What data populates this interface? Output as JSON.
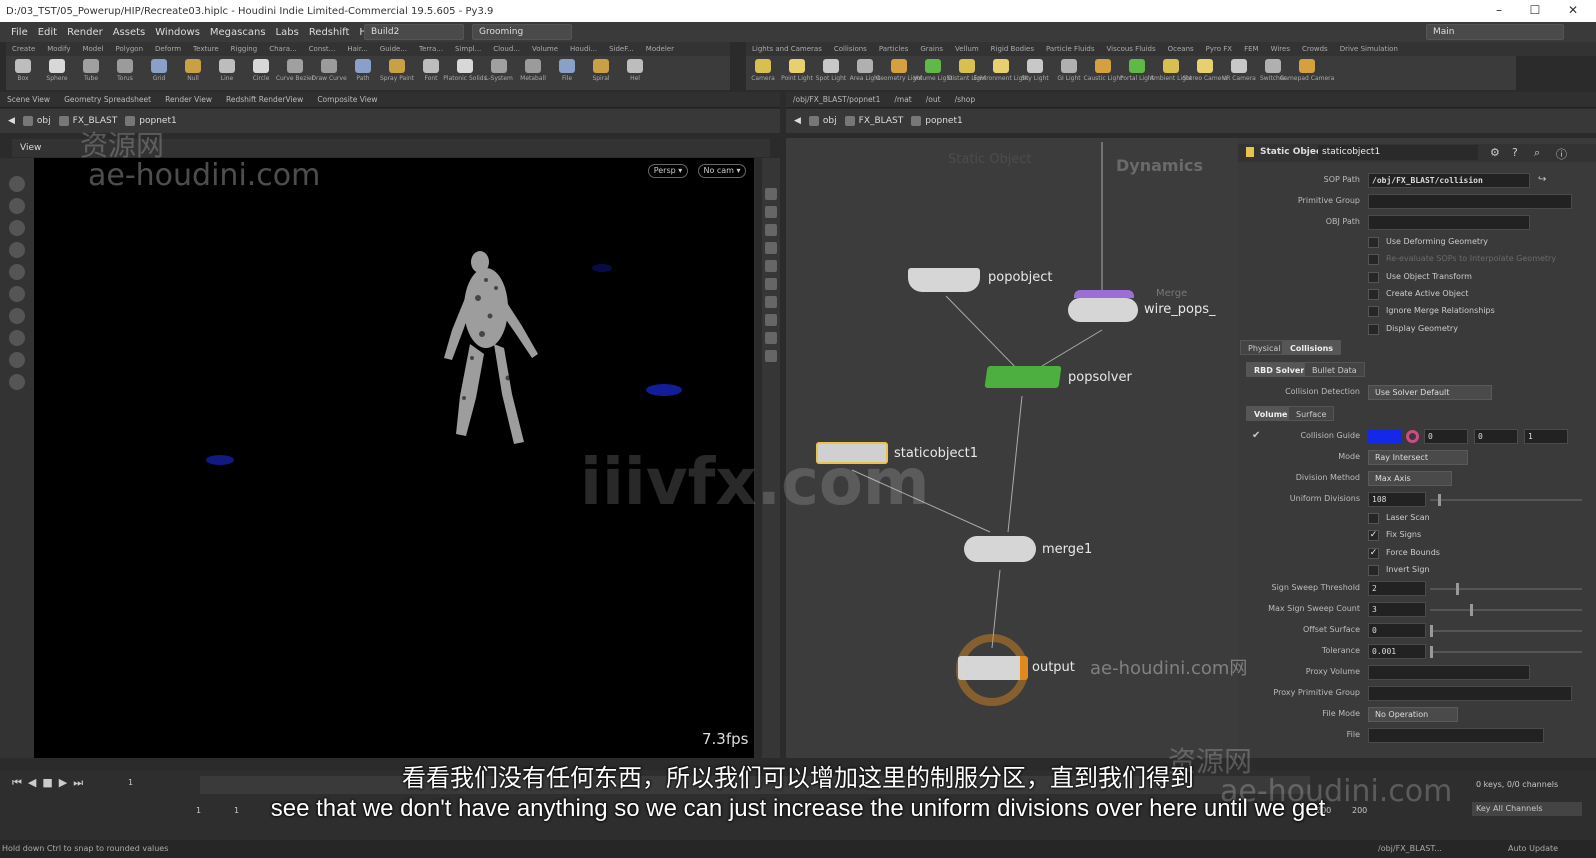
{
  "window": {
    "title": "D:/03_TST/05_Powerup/HIP/Recreate03.hiplc - Houdini Indie Limited-Commercial 19.5.605 - Py3.9"
  },
  "menu": [
    "File",
    "Edit",
    "Render",
    "Assets",
    "Windows",
    "Megascans",
    "Labs",
    "Redshift",
    "Help"
  ],
  "desktop": {
    "build": "Build2",
    "grooming": "Grooming",
    "main": "Main"
  },
  "shelf_tabs_left": [
    "Create",
    "Modify",
    "Model",
    "Polygon",
    "Deform",
    "Texture",
    "Rigging",
    "Chara...",
    "Const...",
    "Hair...",
    "Guide...",
    "Terra...",
    "Simpl...",
    "Cloud...",
    "Volume",
    "Houdi...",
    "SideF...",
    "Modeler"
  ],
  "shelf_tabs_right": [
    "Lights and Cameras",
    "Collisions",
    "Particles",
    "Grains",
    "Vellum",
    "Rigid Bodies",
    "Particle Fluids",
    "Viscous Fluids",
    "Oceans",
    "Pyro FX",
    "FEM",
    "Wires",
    "Crowds",
    "Drive Simulation"
  ],
  "tools_left": [
    "Box",
    "Sphere",
    "Tube",
    "Torus",
    "Grid",
    "Null",
    "Line",
    "Circle",
    "Curve Bezier",
    "Draw Curve",
    "Path",
    "Spray Paint",
    "Font",
    "Platonic Solids",
    "L-System",
    "Metaball",
    "File",
    "Spiral",
    "Hel"
  ],
  "tools_right": [
    "Camera",
    "Point Light",
    "Spot Light",
    "Area Light",
    "Geometry Light",
    "Volume Light",
    "Distant Light",
    "Environment Light",
    "Sky Light",
    "GI Light",
    "Caustic Light",
    "Portal Light",
    "Ambient Light",
    "Stereo Camera",
    "VR Camera",
    "Switcher",
    "Gamepad Camera"
  ],
  "left_pane_tabs": [
    "Scene View",
    "Geometry Spreadsheet",
    "Render View",
    "Redshift RenderView",
    "Composite View"
  ],
  "right_pane_tabs": [
    "/obj/FX_BLAST/popnet1",
    "/mat",
    "/out",
    "/shop"
  ],
  "left_path": {
    "obj": "obj",
    "fx": "FX_BLAST",
    "node": "popnet1"
  },
  "right_path": {
    "obj": "obj",
    "fx": "FX_BLAST",
    "node": "popnet1"
  },
  "viewport": {
    "label": "View",
    "persp": "Persp ▾",
    "cam": "No cam ▾",
    "fps": "7.3fps"
  },
  "network": {
    "context_label": "Dynamics",
    "faded_label": "Static Object",
    "nodes": {
      "popobject": "popobject",
      "merge_small": "Merge",
      "wire_pops": "wire_pops_",
      "popsolver": "popsolver",
      "staticobject1": "staticobject1",
      "merge1": "merge1",
      "output": "output"
    }
  },
  "params": {
    "node_type": "Static Object",
    "node_name": "staticobject1",
    "sop_path_label": "SOP Path",
    "sop_path": "/obj/FX_BLAST/collision",
    "prim_group_label": "Primitive Group",
    "obj_path_label": "OBJ Path",
    "checks_top": [
      {
        "label": "Use Deforming Geometry",
        "checked": false
      },
      {
        "label": "Re-evaluate SOPs to Interpolate Geometry",
        "checked": false
      },
      {
        "label": "Use Object Transform",
        "checked": false
      },
      {
        "label": "Create Active Object",
        "checked": false
      },
      {
        "label": "Ignore Merge Relationships",
        "checked": false
      },
      {
        "label": "Display Geometry",
        "checked": false
      }
    ],
    "tabs_main": [
      "Physical",
      "Collisions"
    ],
    "tabs_sub": [
      "RBD Solver",
      "Bullet Data"
    ],
    "collision_detection_label": "Collision Detection",
    "collision_detection": "Use Solver Default",
    "tabs_vol": [
      "Volume",
      "Surface"
    ],
    "collision_guide_label": "Collision Guide",
    "collision_guide_color": "#1428e8",
    "collision_guide_values": [
      "0",
      "0",
      "1"
    ],
    "mode_label": "Mode",
    "mode": "Ray Intersect",
    "division_method_label": "Division Method",
    "division_method": "Max Axis",
    "uniform_divisions_label": "Uniform Divisions",
    "uniform_divisions": "108",
    "checks_mid": [
      {
        "label": "Laser Scan",
        "checked": false
      },
      {
        "label": "Fix Signs",
        "checked": true
      },
      {
        "label": "Force Bounds",
        "checked": true
      },
      {
        "label": "Invert Sign",
        "checked": false
      }
    ],
    "sign_sweep_threshold_label": "Sign Sweep Threshold",
    "sign_sweep_threshold": "2",
    "max_sign_sweep_label": "Max Sign Sweep Count",
    "max_sign_sweep": "3",
    "offset_surface_label": "Offset Surface",
    "offset_surface": "0",
    "tolerance_label": "Tolerance",
    "tolerance": "0.001",
    "proxy_volume_label": "Proxy Volume",
    "proxy_prim_group_label": "Proxy Primitive Group",
    "file_mode_label": "File Mode",
    "file_mode": "No Operation",
    "file_label": "File"
  },
  "timeline": {
    "frame": "1",
    "start": "1",
    "start2": "1",
    "end": "200",
    "end2": "200",
    "keys": "0 keys, 0/0 channels",
    "key_all": "Key All Channels",
    "auto_update": "Auto Update",
    "obj_path": "/obj/FX_BLAST..."
  },
  "status": "Hold down Ctrl to snap to rounded values",
  "subtitles": {
    "cn": "看看我们没有任何东西，所以我们可以增加这里的制服分区，直到我们得到",
    "en": "see that we don't have anything so we can just increase the uniform divisions over here until we get"
  },
  "watermarks": {
    "w1": "资源网",
    "w2": "ae-houdini.com",
    "w3": "iiivfx.com",
    "w4": "ae-houdini.com网",
    "w5": "资源网",
    "w6": "ae-houdini.com"
  },
  "colors": {
    "popsolver": "#4caf3f",
    "staticobject": "#e8c54a",
    "output": "#e08a1e",
    "merge_purple": "#9b6fd6"
  }
}
